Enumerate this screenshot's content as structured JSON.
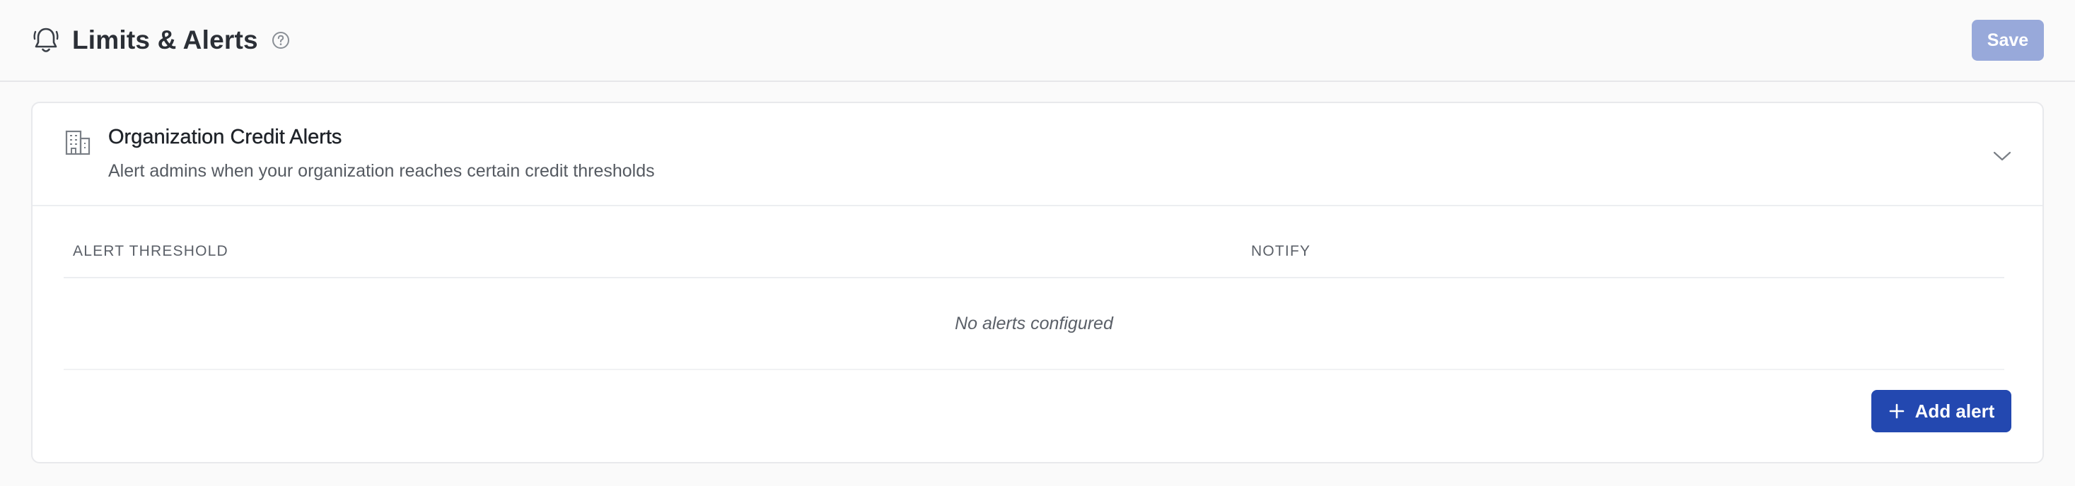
{
  "header": {
    "title": "Limits & Alerts",
    "icon": "bell-icon",
    "help_icon": "help-circle-icon",
    "save_label": "Save"
  },
  "card": {
    "icon": "building-icon",
    "title": "Organization Credit Alerts",
    "subtitle": "Alert admins when your organization reaches certain credit thresholds",
    "toggle_icon": "chevron-down-icon",
    "table": {
      "columns": [
        "ALERT THRESHOLD",
        "NOTIFY"
      ],
      "rows": [],
      "empty_message": "No alerts configured"
    },
    "add_label": "Add alert",
    "add_icon": "plus-icon"
  },
  "colors": {
    "save_button_disabled": "#98a9da",
    "primary_button": "#2348b0",
    "page_background": "#fafafa",
    "card_background": "#ffffff"
  }
}
